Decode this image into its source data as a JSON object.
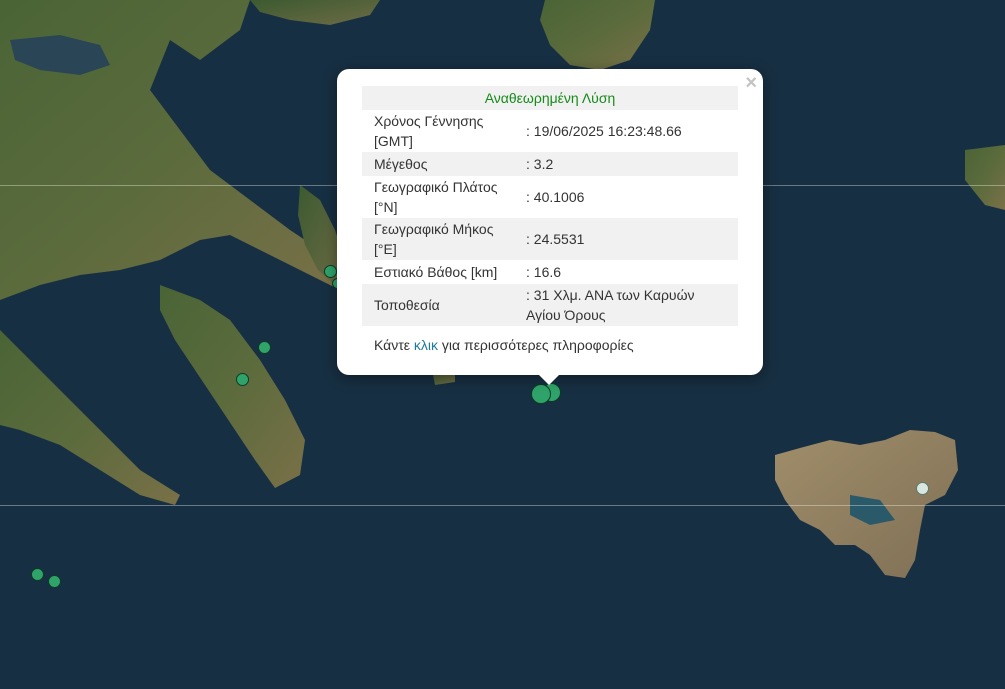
{
  "map": {
    "markers": [
      {
        "id": "m1",
        "color": "#2fa36a"
      },
      {
        "id": "m2",
        "color": "#2fa36a"
      },
      {
        "id": "m3",
        "color": "#2fa36a"
      },
      {
        "id": "m4",
        "color": "#2fa36a"
      },
      {
        "id": "m5",
        "color": "#2fa36a"
      },
      {
        "id": "m6",
        "color": "#2fa36a"
      },
      {
        "id": "m7",
        "color": "#2fa36a"
      },
      {
        "id": "m8",
        "color": "#2fa36a"
      },
      {
        "id": "m9",
        "color": "#2fa36a"
      }
    ]
  },
  "popup": {
    "title": "Αναθεωρημένη Λύση",
    "close_icon": "×",
    "rows": [
      {
        "label": "Χρόνος Γέννησης [GMT]",
        "value": ": 19/06/2025 16:23:48.66"
      },
      {
        "label": "Μέγεθος",
        "value": ": 3.2"
      },
      {
        "label": "Γεωγραφικό Πλάτος [°N]",
        "value": ": 40.1006"
      },
      {
        "label": "Γεωγραφικό Μήκος [°E]",
        "value": ": 24.5531"
      },
      {
        "label": "Εστιακό Βάθος [km]",
        "value": ": 16.6"
      },
      {
        "label": "Τοποθεσία",
        "value": ": 31 Χλμ. ΑΝΑ των Καρυών Αγίου Όρους"
      }
    ],
    "footer_prefix": "Κάντε ",
    "footer_link": "κλικ",
    "footer_suffix": " για περισσότερες πληροφορίες"
  },
  "colors": {
    "sea": "#1b3348",
    "land_green": "#3f5a2e",
    "land_brown": "#8a7a5a",
    "marker": "#2fa36a",
    "title_green": "#178a1b",
    "link": "#1f7a9a"
  }
}
